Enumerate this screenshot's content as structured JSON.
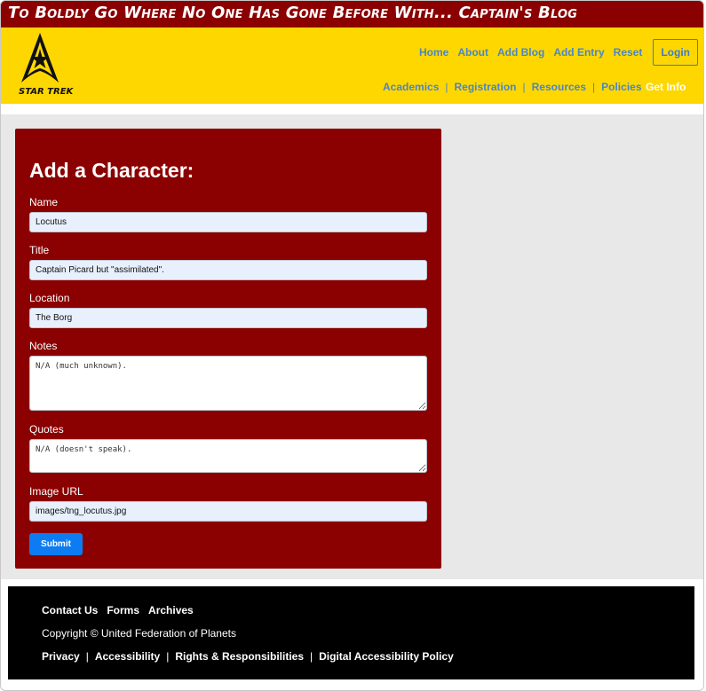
{
  "banner": {
    "title": "To Boldly Go Where No One Has Gone Before With... Captain's Blog"
  },
  "logo": {
    "text": "STAR TREK",
    "icon": "starfleet-delta-icon"
  },
  "nav": {
    "top": [
      "Home",
      "About",
      "Add Blog",
      "Add Entry",
      "Reset"
    ],
    "login": "Login",
    "bottom": [
      "Academics",
      "Registration",
      "Resources",
      "Policies"
    ],
    "separator": "|",
    "get_info": "Get Info"
  },
  "form": {
    "heading": "Add a Character:",
    "name_label": "Name",
    "name_value": "Locutus",
    "title_label": "Title",
    "title_value": "Captain Picard but \"assimilated\".",
    "location_label": "Location",
    "location_value": "The Borg",
    "notes_label": "Notes",
    "notes_value": "N/A (much unknown).",
    "quotes_label": "Quotes",
    "quotes_value": "N/A (doesn't speak).",
    "image_label": "Image URL",
    "image_value": "images/tng_locutus.jpg",
    "submit": "Submit"
  },
  "footer": {
    "links": [
      "Contact Us",
      "Forms",
      "Archives"
    ],
    "copyright": "Copyright © United Federation of Planets",
    "policies": [
      "Privacy",
      "Accessibility",
      "Rights & Responsibilities",
      "Digital Accessibility Policy"
    ],
    "separator": "|"
  },
  "colors": {
    "banner": "#8b0000",
    "header": "#ffd700",
    "card": "#8b0000",
    "link": "#4a86c8",
    "submit": "#0d7cf2",
    "footer": "#000000"
  }
}
